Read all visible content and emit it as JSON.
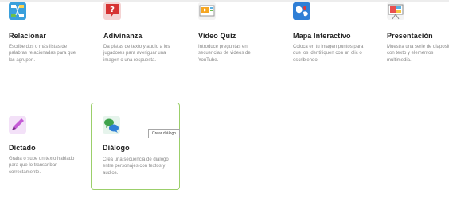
{
  "cards": [
    {
      "title": "Relacionar",
      "desc": "Escribe dos o más listas de palabras relacionadas para que las agrupen.",
      "icon": "relate-icon"
    },
    {
      "title": "Adivinanza",
      "desc": "Da pistas de texto y audio a los jugadores para averiguar una imagen o una respuesta.",
      "icon": "question-mark-icon"
    },
    {
      "title": "Video Quiz",
      "desc": "Introduce preguntas en secuencias de videos de YouTube.",
      "icon": "video-quiz-icon"
    },
    {
      "title": "Mapa Interactivo",
      "desc": "Coloca en tu imagen puntos para que los identifiquen con un clic o escribiendo.",
      "icon": "map-icon"
    },
    {
      "title": "Presentación",
      "desc": "Muestra una serie de diapositivas con texto y elementos multimedia.",
      "icon": "presentation-icon"
    },
    {
      "title": "Dictado",
      "desc": "Graba o sube un texto hablado para que lo transcriban correctamente.",
      "icon": "pen-icon"
    },
    {
      "title": "Diálogo",
      "desc": "Crea una secuencia de diálogo entre personajes con textos y audios.",
      "icon": "dialogue-icon"
    }
  ],
  "tooltip": {
    "text": "Crear diálogo"
  },
  "colors": {
    "selected_border": "#9bcf6a",
    "title": "#222222",
    "desc": "#888888"
  }
}
